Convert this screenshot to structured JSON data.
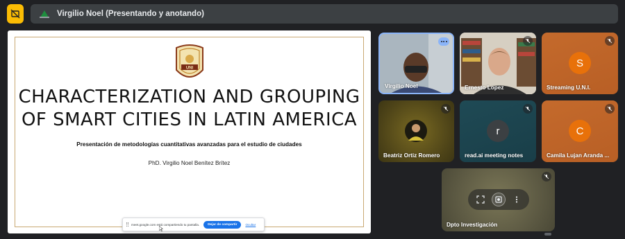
{
  "topbar": {
    "presenter_title": "Virgilio Noel (Presentando y anotando)"
  },
  "slide": {
    "title_line1": "CHARACTERIZATION AND GROUPING",
    "title_line2": "OF SMART CITIES IN LATIN AMERICA",
    "subtitle": "Presentación de metodologías cuantitativas avanzadas para el estudio de ciudades",
    "author": "PhD. Virgilio Noel Benítez Brítez",
    "logo_text": "UNI"
  },
  "share_bar": {
    "message": "meet.google.com está compartiendo tu pantalla.",
    "stop_label": "Dejar de compartir",
    "hide_label": "Ocultar"
  },
  "participants": [
    {
      "name": "Virgilio Noel",
      "muted": false
    },
    {
      "name": "Ernesto Lopez",
      "muted": true
    },
    {
      "name": "Streaming U.N.I.",
      "muted": true,
      "initial": "S"
    },
    {
      "name": "Beatriz Ortiz Romero",
      "muted": true
    },
    {
      "name": "read.ai meeting notes",
      "muted": true,
      "initial": "r"
    },
    {
      "name": "Camila Lujan Aranda ...",
      "muted": true,
      "initial": "C"
    },
    {
      "name": "Dpto Investigación",
      "muted": true
    }
  ],
  "colors": {
    "accent_yellow": "#fbbc04",
    "accent_blue": "#1a73e8",
    "active_border": "#8ab4f8",
    "orange_tile": "#c46a2c",
    "teal_tile": "#1f4a55"
  }
}
